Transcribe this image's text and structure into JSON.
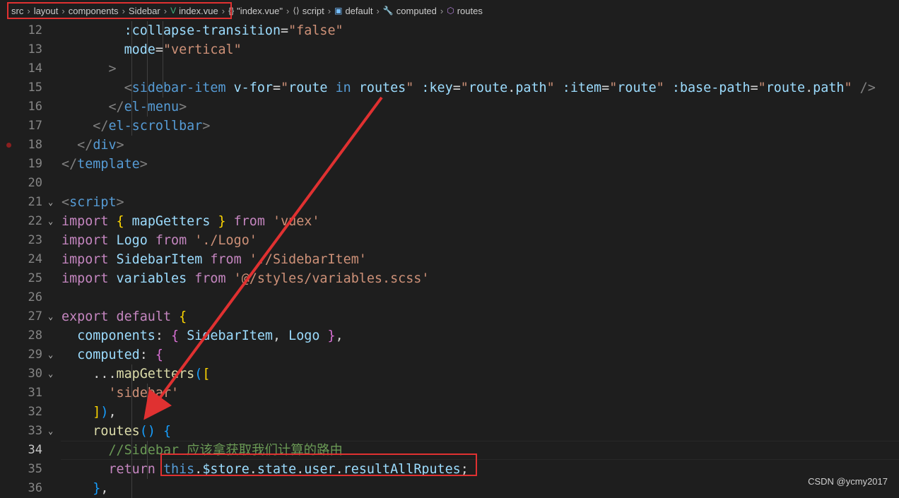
{
  "breadcrumb": [
    {
      "label": "src",
      "icon": "",
      "icon_name": "",
      "color": "#cccccc"
    },
    {
      "label": "layout",
      "icon": "",
      "icon_name": "",
      "color": "#cccccc"
    },
    {
      "label": "components",
      "icon": "",
      "icon_name": "",
      "color": "#cccccc"
    },
    {
      "label": "Sidebar",
      "icon": "",
      "icon_name": "",
      "color": "#cccccc"
    },
    {
      "label": "index.vue",
      "icon": "V",
      "icon_name": "vue-file-icon",
      "color": "#41b883"
    },
    {
      "label": "\"index.vue\"",
      "icon": "{}",
      "icon_name": "braces-icon",
      "color": "#cccccc"
    },
    {
      "label": "script",
      "icon": "⟨⟩",
      "icon_name": "script-icon",
      "color": "#cccccc"
    },
    {
      "label": "default",
      "icon": "▣",
      "icon_name": "symbol-variable-icon",
      "color": "#75beff"
    },
    {
      "label": "computed",
      "icon": "🔧",
      "icon_name": "wrench-icon",
      "color": "#cccccc"
    },
    {
      "label": "routes",
      "icon": "⬡",
      "icon_name": "symbol-method-icon",
      "color": "#b180d7"
    }
  ],
  "colors": {
    "highlight_box": "#e03131",
    "arrow": "#e03131",
    "breakpoint": "#8b1f1f"
  },
  "lines": [
    {
      "n": "12",
      "fold": "",
      "guides": [
        1,
        2,
        3
      ],
      "tokens": [
        [
          "                ",
          ""
        ],
        [
          ":collapse-transition",
          "attr"
        ],
        [
          "=",
          "plain"
        ],
        [
          "\"false\"",
          "str"
        ]
      ]
    },
    {
      "n": "13",
      "fold": "",
      "guides": [
        1,
        2,
        3
      ],
      "tokens": [
        [
          "                ",
          ""
        ],
        [
          "mode",
          "attr"
        ],
        [
          "=",
          "plain"
        ],
        [
          "\"vertical\"",
          "str"
        ]
      ]
    },
    {
      "n": "14",
      "fold": "",
      "guides": [
        1,
        2,
        3
      ],
      "tokens": [
        [
          "              ",
          ""
        ],
        [
          ">",
          "punc"
        ]
      ]
    },
    {
      "n": "15",
      "fold": "",
      "guides": [
        1,
        2,
        3
      ],
      "tokens": [
        [
          "                ",
          ""
        ],
        [
          "<",
          "punc"
        ],
        [
          "sidebar-item",
          "tag"
        ],
        [
          " ",
          ""
        ],
        [
          "v-for",
          "attr"
        ],
        [
          "=",
          "plain"
        ],
        [
          "\"",
          "str"
        ],
        [
          "route",
          "var"
        ],
        [
          " in ",
          "stor"
        ],
        [
          "routes",
          "var"
        ],
        [
          "\"",
          "str"
        ],
        [
          " ",
          ""
        ],
        [
          ":key",
          "attr"
        ],
        [
          "=",
          "plain"
        ],
        [
          "\"",
          "str"
        ],
        [
          "route",
          "var"
        ],
        [
          ".",
          "plain"
        ],
        [
          "path",
          "var"
        ],
        [
          "\"",
          "str"
        ],
        [
          " ",
          ""
        ],
        [
          ":item",
          "attr"
        ],
        [
          "=",
          "plain"
        ],
        [
          "\"",
          "str"
        ],
        [
          "route",
          "var"
        ],
        [
          "\"",
          "str"
        ],
        [
          " ",
          ""
        ],
        [
          ":base-path",
          "attr"
        ],
        [
          "=",
          "plain"
        ],
        [
          "\"",
          "str"
        ],
        [
          "route",
          "var"
        ],
        [
          ".",
          "plain"
        ],
        [
          "path",
          "var"
        ],
        [
          "\"",
          "str"
        ],
        [
          " ",
          ""
        ],
        [
          "/>",
          "punc"
        ]
      ]
    },
    {
      "n": "16",
      "fold": "",
      "guides": [
        1,
        2
      ],
      "tokens": [
        [
          "              ",
          ""
        ],
        [
          "</",
          "punc"
        ],
        [
          "el-menu",
          "tag"
        ],
        [
          ">",
          "punc"
        ]
      ]
    },
    {
      "n": "17",
      "fold": "",
      "guides": [
        1
      ],
      "tokens": [
        [
          "            ",
          ""
        ],
        [
          "</",
          "punc"
        ],
        [
          "el-scrollbar",
          "tag"
        ],
        [
          ">",
          "punc"
        ]
      ]
    },
    {
      "n": "18",
      "fold": "",
      "bp": true,
      "guides": [],
      "tokens": [
        [
          "          ",
          ""
        ],
        [
          "</",
          "punc"
        ],
        [
          "div",
          "tag"
        ],
        [
          ">",
          "punc"
        ]
      ]
    },
    {
      "n": "19",
      "fold": "",
      "guides": [],
      "tokens": [
        [
          "        ",
          ""
        ],
        [
          "</",
          "punc"
        ],
        [
          "template",
          "tag"
        ],
        [
          ">",
          "punc"
        ]
      ]
    },
    {
      "n": "20",
      "fold": "",
      "guides": [],
      "tokens": []
    },
    {
      "n": "21",
      "fold": "v",
      "guides": [],
      "tokens": [
        [
          "        ",
          ""
        ],
        [
          "<",
          "punc"
        ],
        [
          "script",
          "tag"
        ],
        [
          ">",
          "punc"
        ]
      ]
    },
    {
      "n": "22",
      "fold": "v",
      "guides": [],
      "tokens": [
        [
          "        ",
          ""
        ],
        [
          "import",
          "kw"
        ],
        [
          " ",
          ""
        ],
        [
          "{",
          "brk1"
        ],
        [
          " ",
          ""
        ],
        [
          "mapGetters",
          "var"
        ],
        [
          " ",
          ""
        ],
        [
          "}",
          "brk1"
        ],
        [
          " ",
          ""
        ],
        [
          "from",
          "kw"
        ],
        [
          " ",
          ""
        ],
        [
          "'vuex'",
          "str"
        ]
      ]
    },
    {
      "n": "23",
      "fold": "",
      "guides": [],
      "tokens": [
        [
          "        ",
          ""
        ],
        [
          "import",
          "kw"
        ],
        [
          " ",
          ""
        ],
        [
          "Logo",
          "var"
        ],
        [
          " ",
          ""
        ],
        [
          "from",
          "kw"
        ],
        [
          " ",
          ""
        ],
        [
          "'./Logo'",
          "str"
        ]
      ]
    },
    {
      "n": "24",
      "fold": "",
      "guides": [],
      "tokens": [
        [
          "        ",
          ""
        ],
        [
          "import",
          "kw"
        ],
        [
          " ",
          ""
        ],
        [
          "SidebarItem",
          "var"
        ],
        [
          " ",
          ""
        ],
        [
          "from",
          "kw"
        ],
        [
          " ",
          ""
        ],
        [
          "'./SidebarItem'",
          "str"
        ]
      ]
    },
    {
      "n": "25",
      "fold": "",
      "guides": [],
      "tokens": [
        [
          "        ",
          ""
        ],
        [
          "import",
          "kw"
        ],
        [
          " ",
          ""
        ],
        [
          "variables",
          "var"
        ],
        [
          " ",
          ""
        ],
        [
          "from",
          "kw"
        ],
        [
          " ",
          ""
        ],
        [
          "'@/styles/variables.scss'",
          "str"
        ]
      ]
    },
    {
      "n": "26",
      "fold": "",
      "guides": [],
      "tokens": []
    },
    {
      "n": "27",
      "fold": "v",
      "guides": [],
      "tokens": [
        [
          "        ",
          ""
        ],
        [
          "export",
          "kw"
        ],
        [
          " ",
          ""
        ],
        [
          "default",
          "kw"
        ],
        [
          " ",
          ""
        ],
        [
          "{",
          "brk1"
        ]
      ]
    },
    {
      "n": "28",
      "fold": "",
      "guides": [],
      "tokens": [
        [
          "          ",
          ""
        ],
        [
          "components",
          "var"
        ],
        [
          ": ",
          "plain"
        ],
        [
          "{",
          "brk2"
        ],
        [
          " ",
          ""
        ],
        [
          "SidebarItem",
          "var"
        ],
        [
          ", ",
          "plain"
        ],
        [
          "Logo",
          "var"
        ],
        [
          " ",
          ""
        ],
        [
          "}",
          "brk2"
        ],
        [
          ",",
          "plain"
        ]
      ]
    },
    {
      "n": "29",
      "fold": "v",
      "guides": [],
      "tokens": [
        [
          "          ",
          ""
        ],
        [
          "computed",
          "var"
        ],
        [
          ": ",
          "plain"
        ],
        [
          "{",
          "brk2"
        ]
      ]
    },
    {
      "n": "30",
      "fold": "v",
      "guides": [
        1
      ],
      "tokens": [
        [
          "            ",
          ""
        ],
        [
          "...",
          "plain"
        ],
        [
          "mapGetters",
          "fn"
        ],
        [
          "(",
          "brk3"
        ],
        [
          "[",
          "brk1"
        ]
      ]
    },
    {
      "n": "31",
      "fold": "",
      "guides": [
        1,
        2
      ],
      "tokens": [
        [
          "              ",
          ""
        ],
        [
          "'sidebar'",
          "str"
        ]
      ]
    },
    {
      "n": "32",
      "fold": "",
      "guides": [
        1
      ],
      "tokens": [
        [
          "            ",
          ""
        ],
        [
          "]",
          "brk1"
        ],
        [
          ")",
          "brk3"
        ],
        [
          ",",
          "plain"
        ]
      ]
    },
    {
      "n": "33",
      "fold": "v",
      "guides": [
        1
      ],
      "tokens": [
        [
          "            ",
          ""
        ],
        [
          "routes",
          "fn"
        ],
        [
          "(",
          "brk3"
        ],
        [
          ")",
          "brk3"
        ],
        [
          " ",
          ""
        ],
        [
          "{",
          "brk3"
        ]
      ]
    },
    {
      "n": "34",
      "fold": "",
      "current": true,
      "guides": [
        1,
        2
      ],
      "tokens": [
        [
          "              ",
          ""
        ],
        [
          "//Sidebar 应该拿获取我们计算的路由",
          "cmt"
        ]
      ]
    },
    {
      "n": "35",
      "fold": "",
      "guides": [
        1,
        2
      ],
      "tokens": [
        [
          "              ",
          ""
        ],
        [
          "return",
          "kw"
        ],
        [
          " ",
          ""
        ],
        [
          "this",
          "this"
        ],
        [
          ".",
          "plain"
        ],
        [
          "$store",
          "var"
        ],
        [
          ".",
          "plain"
        ],
        [
          "state",
          "var"
        ],
        [
          ".",
          "plain"
        ],
        [
          "user",
          "var"
        ],
        [
          ".",
          "plain"
        ],
        [
          "resultAllRputes",
          "var"
        ],
        [
          ";",
          "plain"
        ]
      ]
    },
    {
      "n": "36",
      "fold": "",
      "guides": [
        1
      ],
      "tokens": [
        [
          "            ",
          ""
        ],
        [
          "}",
          "brk3"
        ],
        [
          ",",
          "plain"
        ]
      ]
    }
  ],
  "watermark": "CSDN @ycmy2017"
}
